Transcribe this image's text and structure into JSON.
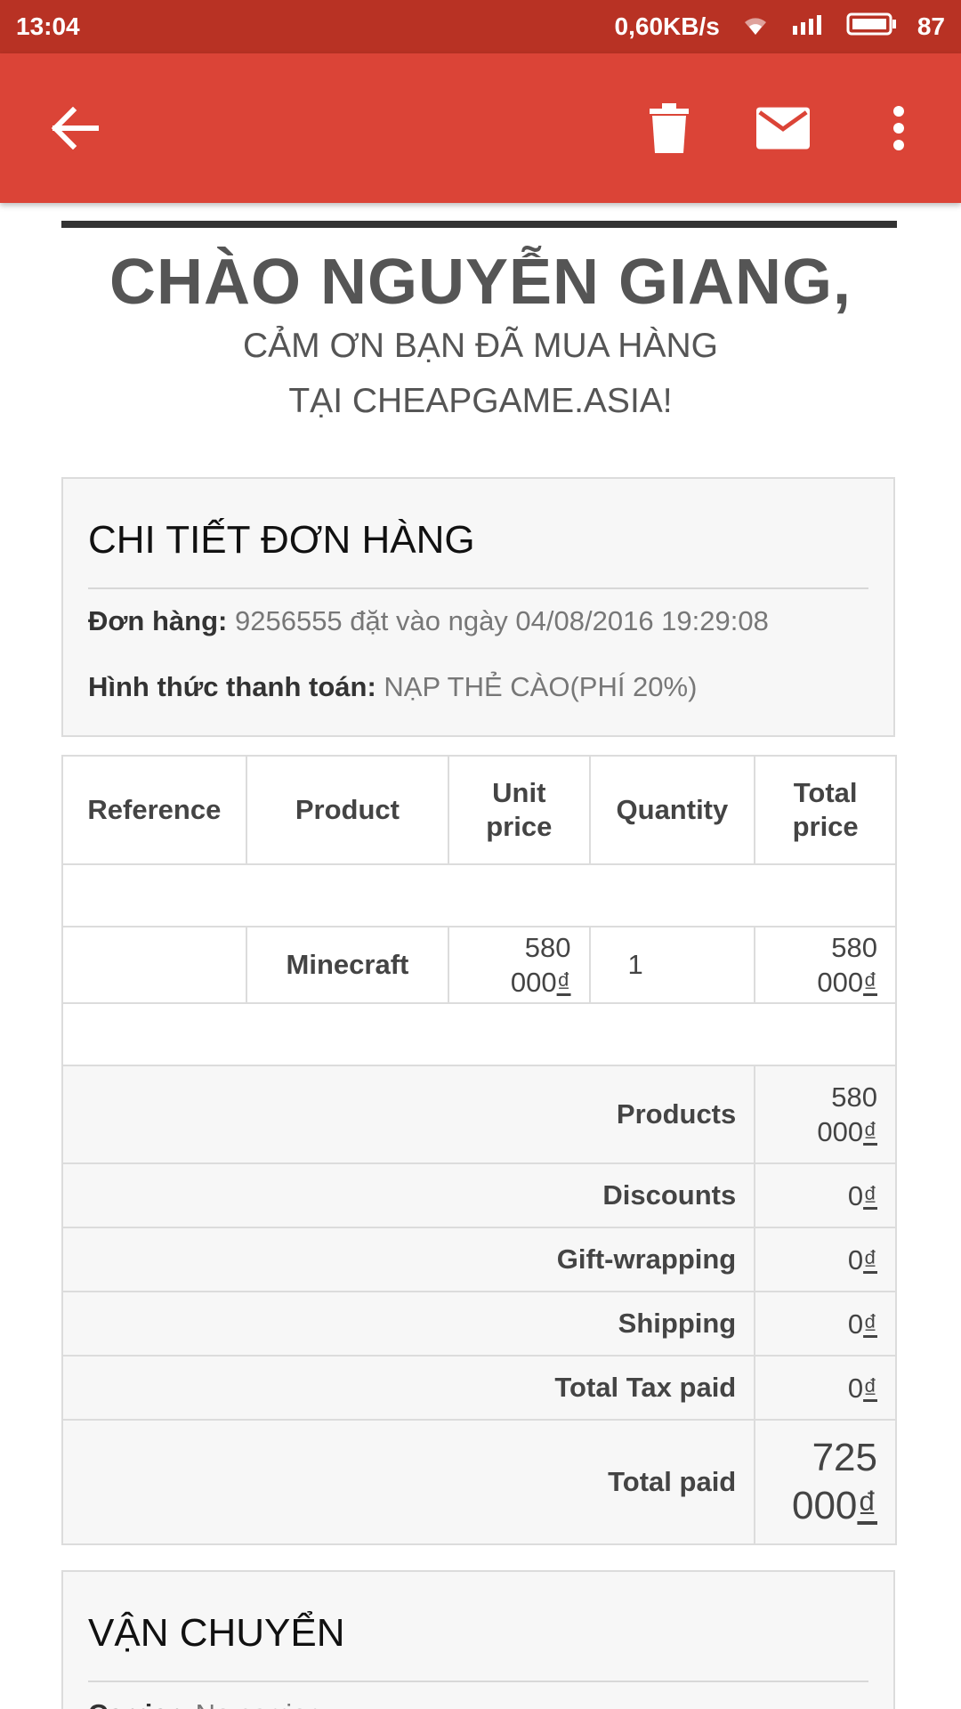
{
  "status_bar": {
    "time": "13:04",
    "network_speed": "0,60KB/s",
    "battery": "87"
  },
  "toolbar": {
    "icons": [
      "back-arrow-icon",
      "trash-icon",
      "mail-icon",
      "more-vert-icon"
    ]
  },
  "email": {
    "greeting": "CHÀO NGUYỄN GIANG,",
    "thanks_line1": "CẢM ƠN BẠN ĐÃ MUA HÀNG",
    "thanks_line2": "TẠI CHEAPGAME.ASIA!",
    "order_details": {
      "title": "CHI TIẾT ĐƠN HÀNG",
      "order_label": "Đơn hàng:",
      "order_value": "9256555 đặt vào ngày 04/08/2016 19:29:08",
      "payment_label": "Hình thức thanh toán:",
      "payment_value": "NẠP THẺ CÀO(PHÍ 20%)"
    },
    "table": {
      "headers": {
        "reference": "Reference",
        "product": "Product",
        "unit_price_1": "Unit",
        "unit_price_2": "price",
        "quantity": "Quantity",
        "total_price_1": "Total",
        "total_price_2": "price"
      },
      "items": [
        {
          "reference": "",
          "product": "Minecraft",
          "unit_price_1": "580",
          "unit_price_2": "000",
          "quantity": "1",
          "total_price_1": "580",
          "total_price_2": "000"
        }
      ],
      "currency": "₫",
      "summary": {
        "products_label": "Products",
        "products_value_1": "580",
        "products_value_2": "000",
        "discounts_label": "Discounts",
        "discounts_value": "0",
        "gift_label": "Gift-wrapping",
        "gift_value": "0",
        "shipping_label": "Shipping",
        "shipping_value": "0",
        "tax_label": "Total Tax paid",
        "tax_value": "0",
        "total_label": "Total paid",
        "total_value_1": "725",
        "total_value_2": "000"
      }
    },
    "shipping_section": {
      "title": "VẬN CHUYỂN",
      "carrier_label": "Carrier:",
      "carrier_value": "No carrier"
    }
  },
  "colors": {
    "status_bar": "#b83224",
    "toolbar": "#db4437"
  }
}
